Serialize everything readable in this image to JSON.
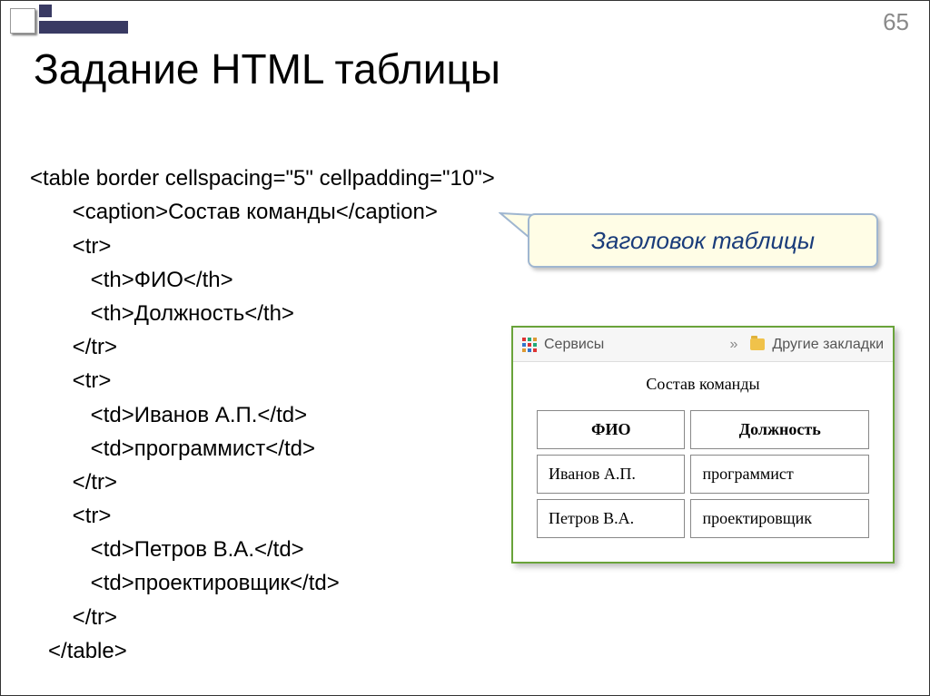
{
  "page_number": "65",
  "title": "Задание HTML таблицы",
  "callout": "Заголовок таблицы",
  "code": {
    "l0": "<table border cellspacing=\"5\" cellpadding=\"10\">",
    "l1": "       <caption>Состав команды</caption>",
    "l2": "       <tr>",
    "l3": "          <th>ФИО</th>",
    "l4": "          <th>Должность</th>",
    "l5": "       </tr>",
    "l6": "       <tr>",
    "l7": "          <td>Иванов А.П.</td>",
    "l8": "          <td>программист</td>",
    "l9": "       </tr>",
    "l10": "       <tr>",
    "l11": "          <td>Петров В.А.</td>",
    "l12": "          <td>проектировщик</td>",
    "l13": "       </tr>",
    "l14": "   </table>"
  },
  "toolbar": {
    "services_label": "Сервисы",
    "chevron": "»",
    "bookmarks_label": "Другие закладки"
  },
  "table": {
    "caption": "Состав команды",
    "headers": {
      "col0": "ФИО",
      "col1": "Должность"
    },
    "rows": [
      {
        "name": "Иванов А.П.",
        "role": "программист"
      },
      {
        "name": "Петров В.А.",
        "role": "проектировщик"
      }
    ]
  }
}
